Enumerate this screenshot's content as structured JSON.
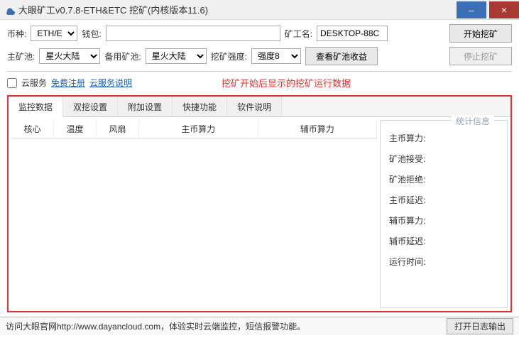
{
  "title": "大眼矿工v0.7.8-ETH&ETC 挖矿(内核版本11.6)",
  "row1": {
    "coin_label": "币种:",
    "coin_value": "ETH/E",
    "wallet_label": "钱包:",
    "wallet_value": "",
    "miner_label": "矿工名:",
    "miner_value": "DESKTOP-88C",
    "start_btn": "开始挖矿"
  },
  "row2": {
    "mainpool_label": "主矿池:",
    "mainpool_value": "星火大陆",
    "backup_label": "备用矿池:",
    "backup_value": "星火大陆",
    "intensity_label": "挖矿强度:",
    "intensity_value": "强度8",
    "view_btn": "查看矿池收益",
    "stop_btn": "停止挖矿"
  },
  "cloud": {
    "label": "云服务",
    "reg": "免费注册",
    "help": "云服务说明",
    "annot": "挖矿开始后显示的挖矿运行数据"
  },
  "tabs": [
    "监控数据",
    "双挖设置",
    "附加设置",
    "快捷功能",
    "软件说明"
  ],
  "thead": [
    "核心",
    "温度",
    "风扇",
    "主币算力",
    "辅币算力"
  ],
  "stats": {
    "legend": "统计信息",
    "items": [
      "主币算力:",
      "矿池接受:",
      "矿池拒绝:",
      "主币延迟:",
      "辅币算力:",
      "辅币延迟:",
      "运行时间:"
    ]
  },
  "footer": {
    "text_pre": "访问大眼官网http://",
    "url": "www.dayancloud.com",
    "text_post": "，体验实时云端监控，短信报警功能。",
    "logbtn": "打开日志输出"
  }
}
